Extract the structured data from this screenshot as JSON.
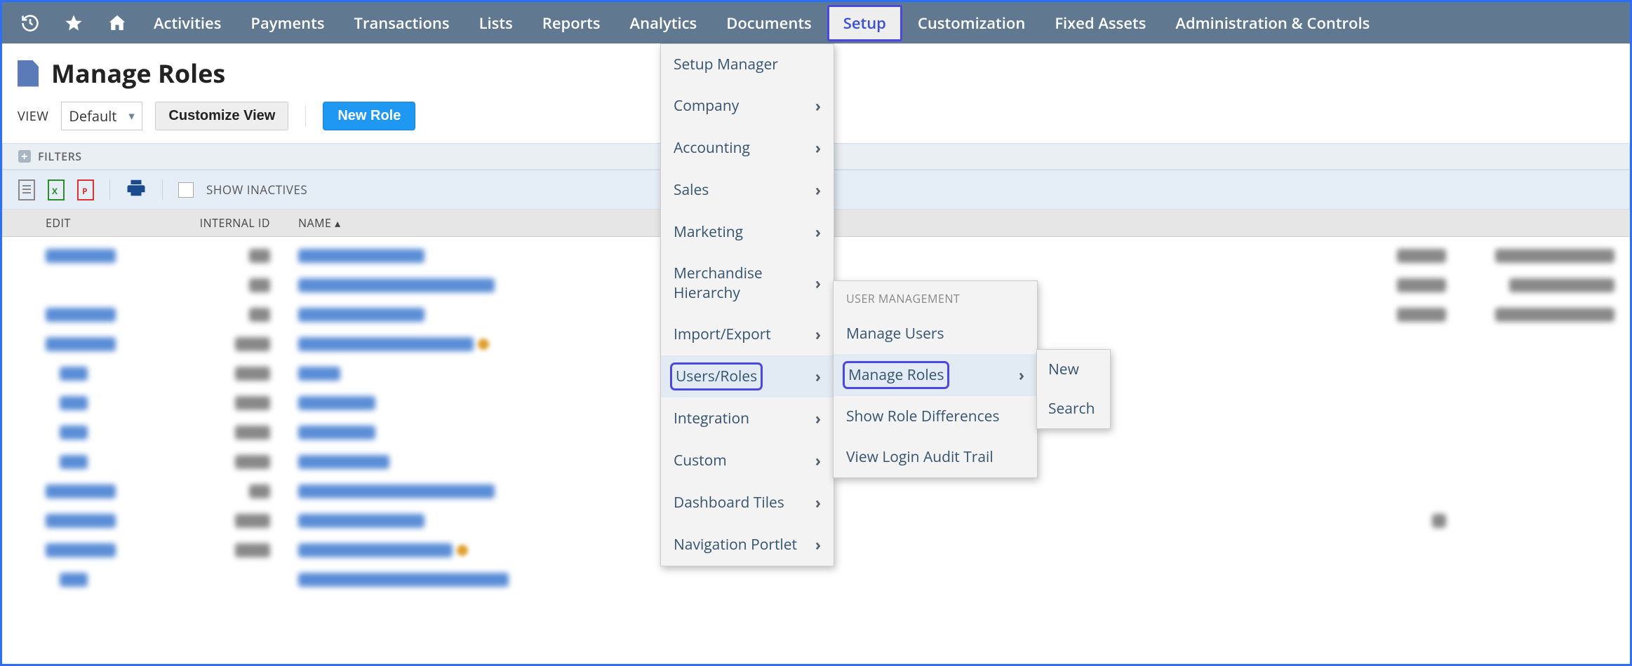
{
  "topnav": {
    "items": [
      "Activities",
      "Payments",
      "Transactions",
      "Lists",
      "Reports",
      "Analytics",
      "Documents",
      "Setup",
      "Customization",
      "Fixed Assets",
      "Administration & Controls"
    ],
    "active_index": 7
  },
  "page": {
    "title": "Manage Roles",
    "view_label": "VIEW",
    "view_value": "Default",
    "customize_btn": "Customize View",
    "new_btn": "New Role"
  },
  "filters_label": "FILTERS",
  "show_inactives": "SHOW INACTIVES",
  "table": {
    "headers": {
      "edit": "EDIT",
      "id": "INTERNAL ID",
      "name": "NAME ▴"
    }
  },
  "dropdown1": [
    {
      "label": "Setup Manager",
      "arrow": false
    },
    {
      "label": "Company",
      "arrow": true
    },
    {
      "label": "Accounting",
      "arrow": true
    },
    {
      "label": "Sales",
      "arrow": true
    },
    {
      "label": "Marketing",
      "arrow": true
    },
    {
      "label": "Merchandise Hierarchy",
      "arrow": true
    },
    {
      "label": "Import/Export",
      "arrow": true
    },
    {
      "label": "Users/Roles",
      "arrow": true,
      "highlight": true,
      "hover": true
    },
    {
      "label": "Integration",
      "arrow": true
    },
    {
      "label": "Custom",
      "arrow": true
    },
    {
      "label": "Dashboard Tiles",
      "arrow": true
    },
    {
      "label": "Navigation Portlet",
      "arrow": true
    }
  ],
  "dropdown2": {
    "header": "USER MANAGEMENT",
    "items": [
      {
        "label": "Manage Users",
        "arrow": false
      },
      {
        "label": "Manage Roles",
        "arrow": true,
        "highlight": true,
        "hover": true
      },
      {
        "label": "Show Role Differences",
        "arrow": false
      },
      {
        "label": "View Login Audit Trail",
        "arrow": false
      }
    ]
  },
  "dropdown3": [
    "New",
    "Search"
  ]
}
